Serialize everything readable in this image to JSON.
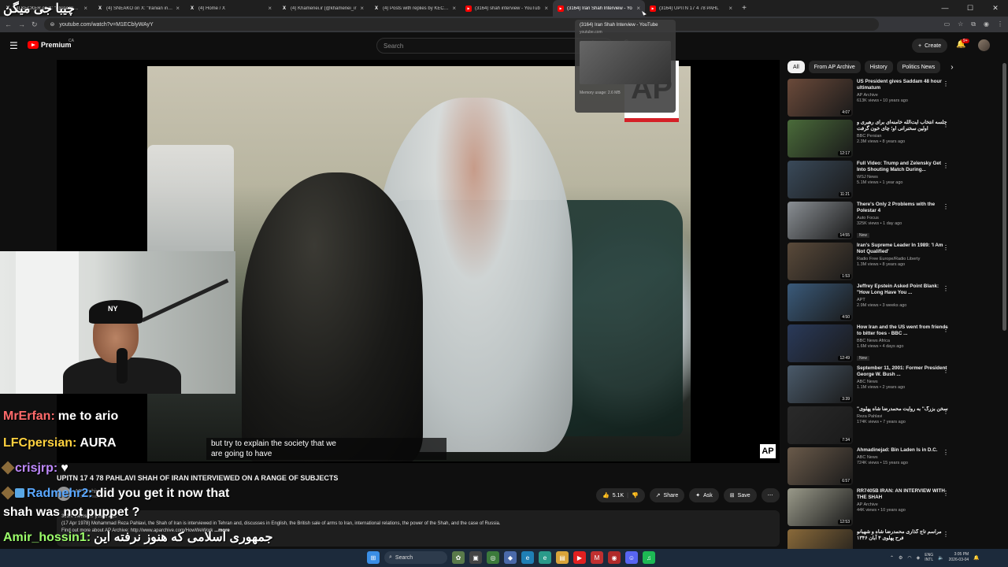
{
  "browser": {
    "tabs": [
      {
        "label": "(4) KECKER on X: \"@sneako Fro",
        "favicon": "x-icon"
      },
      {
        "label": "(4) SNEAKO on X: \"Iranian influ",
        "favicon": "x-icon"
      },
      {
        "label": "(4) Home / X",
        "favicon": "x-icon"
      },
      {
        "label": "(4) Khamenei.ir (@khamenei_ir",
        "favicon": "x-icon"
      },
      {
        "label": "(4) Posts with replies by KECKE",
        "favicon": "x-icon"
      },
      {
        "label": "(3164) shah interview - YouTub",
        "favicon": "youtube-icon"
      },
      {
        "label": "(3164) Iran Shah Interview - Yo",
        "favicon": "youtube-icon",
        "active": true
      },
      {
        "label": "(3164) UPITN 17 4 78 PAHL",
        "favicon": "youtube-icon"
      }
    ],
    "url": "youtube.com/watch?v=M1ECblyWAyY",
    "tooltip": {
      "title": "(3164) Iran Shah Interview - YouTube",
      "domain": "youtube.com",
      "memory": "Memory usage: 2.6 MB"
    }
  },
  "youtube": {
    "logo_text": "Premium",
    "country": "CA",
    "search_placeholder": "Search",
    "create_label": "Create",
    "notification_count": "9+"
  },
  "video": {
    "subtitle_line1": "but try to explain the society that we",
    "subtitle_line2": "are going to have",
    "watermark": "AP",
    "title": "UPITN 17 4 78 PAHLAVI SHAH OF IRAN INTERVIEWED ON A RANGE OF SUBJECTS",
    "channel": "AP Archive",
    "subscribers": "5.93M subscribers",
    "likes": "5.1K",
    "share_label": "Share",
    "ask_label": "Ask",
    "save_label": "Save",
    "views_meta": "363K views  10 years ago",
    "description": "(17 Apr 1978) Mohammad Reza Pahlavi, the Shah of Iran is interviewed in Tehran and, discusses in English, the British sale of arms to Iran, international relations, the power of the Shah, and the case of Russia.",
    "description_line2": "Find out more about AP Archive: http://www.aparchive.com/HowWeWork",
    "more_label": "...more"
  },
  "chips": [
    "All",
    "From AP Archive",
    "History",
    "Politics News"
  ],
  "recommendations": [
    {
      "title": "US President gives Saddam 48 hour ultimatum",
      "channel": "AP Archive",
      "meta": "613K views • 10 years ago",
      "duration": "4:07",
      "color": "#6b4a3a",
      "new": false
    },
    {
      "title": "جلسه انتخاب آیت‌الله خامنه‌ای برای رهبری و اولین سخنرانی او؛ چای خون گرفت",
      "channel": "BBC Persian",
      "meta": "2.3M views • 8 years ago",
      "duration": "12:17",
      "color": "#4a6b3a",
      "new": false
    },
    {
      "title": "Full Video: Trump and Zelensky Get Into Shouting Match During...",
      "channel": "WSJ News",
      "meta": "5.1M views • 1 year ago",
      "duration": "11:21",
      "color": "#3a4a5a",
      "new": false
    },
    {
      "title": "There's Only 2 Problems with the Polestar 4",
      "channel": "Auto Focus",
      "meta": "325K views • 1 day ago",
      "duration": "14:55",
      "color": "#8a8f94",
      "new": true
    },
    {
      "title": "Iran's Supreme Leader In 1989: 'I Am Not Qualified'",
      "channel": "Radio Free Europe/Radio Liberty",
      "meta": "1.3M views • 8 years ago",
      "duration": "1:53",
      "color": "#5a4a3a",
      "new": false
    },
    {
      "title": "Jeffrey Epstein Asked Point Blank: \"How Long Have You ...",
      "channel": "APT",
      "meta": "2.9M views • 3 weeks ago",
      "duration": "4:50",
      "color": "#3a5a7a",
      "new": false
    },
    {
      "title": "How Iran and the US went from friends to bitter foes - BBC ...",
      "channel": "BBC News Africa",
      "meta": "1.6M views • 4 days ago",
      "duration": "12:49",
      "color": "#2a3a5a",
      "new": true
    },
    {
      "title": "September 11, 2001: Former President George W. Bush ...",
      "channel": "ABC News",
      "meta": "1.1M views • 2 years ago",
      "duration": "3:39",
      "color": "#4a5a6a",
      "new": false
    },
    {
      "title": "\"سخن بزرگ\" به روایت محمدرضا شاه پهلوی",
      "channel": "Reza Pahlavi",
      "meta": "174K views • 7 years ago",
      "duration": "7:34",
      "color": "#2a2a2a",
      "new": false
    },
    {
      "title": "Ahmadinejad: Bin Laden Is in D.C.",
      "channel": "ABC News",
      "meta": "724K views • 15 years ago",
      "duration": "6:57",
      "color": "#6a5a4a",
      "new": false
    },
    {
      "title": "RR7405B IRAN: AN INTERVIEW WITH THE SHAH",
      "channel": "AP Archive",
      "meta": "44K views • 10 years ago",
      "duration": "12:53",
      "color": "#9a9a8a",
      "new": false
    },
    {
      "title": "مراسم تاج گذاری محمدرضا شاه و شهبانو فرح پهلوی ۴ آبان ۱۳۴۶",
      "channel": "",
      "meta": "",
      "duration": "",
      "color": "#8a6a3a",
      "new": false
    }
  ],
  "chat": [
    {
      "user": "MrErfan:",
      "message": "me to ario",
      "color": "#ff6b6b",
      "badge": ""
    },
    {
      "user": "LFCpersian:",
      "message": "AURA",
      "color": "#ffd23f",
      "badge": ""
    },
    {
      "user": "crisjrp:",
      "message": "♥",
      "color": "#c08aff",
      "badge": "diamond"
    },
    {
      "user": "Radmehr2:",
      "message": "did you get it now that",
      "color": "#5aa8ff",
      "badge": "diamond-cube"
    },
    {
      "user": "",
      "message": "shah was not puppet ?",
      "color": "#ffffff",
      "badge": ""
    },
    {
      "user": "Amir_hossin1:",
      "message": "جمهوری اسلامی که هنوز نرفته این",
      "color": "#9dff6b",
      "badge": ""
    },
    {
      "user": "",
      "message": "چیبا جی میگن",
      "color": "#ffffff",
      "badge": ""
    }
  ],
  "taskbar": {
    "search_label": "Search",
    "lang_top": "ENG",
    "lang_bottom": "INTL",
    "time": "3:05 PM",
    "date": "2026-03-04"
  }
}
